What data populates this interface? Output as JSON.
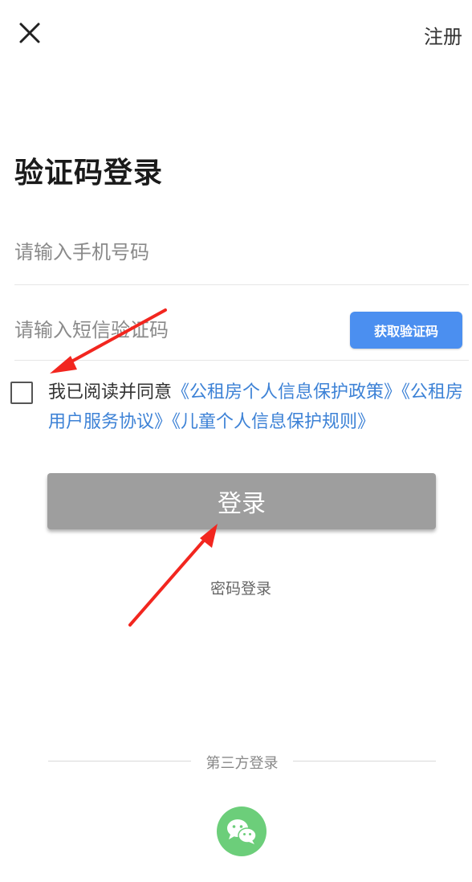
{
  "header": {
    "close_icon": "close-icon",
    "register_label": "注册"
  },
  "title": "验证码登录",
  "phone": {
    "placeholder": "请输入手机号码",
    "value": ""
  },
  "sms_code": {
    "placeholder": "请输入短信验证码",
    "value": "",
    "get_code_label": "获取验证码"
  },
  "agreement": {
    "checked": false,
    "prefix": "我已阅读并同意",
    "link1": "《公租房个人信息保护政策》",
    "link2": "《公租房用户服务协议》",
    "link3": "《儿童个人信息保护规则》"
  },
  "login_button_label": "登录",
  "password_login_label": "密码登录",
  "third_party": {
    "label": "第三方登录",
    "icon": "wechat-icon"
  },
  "colors": {
    "accent_blue": "#4b8ff0",
    "link_blue": "#3d82d6",
    "login_disabled": "#9e9e9e",
    "wechat_green": "#6cce7a",
    "annotation_red": "#f2261f"
  }
}
